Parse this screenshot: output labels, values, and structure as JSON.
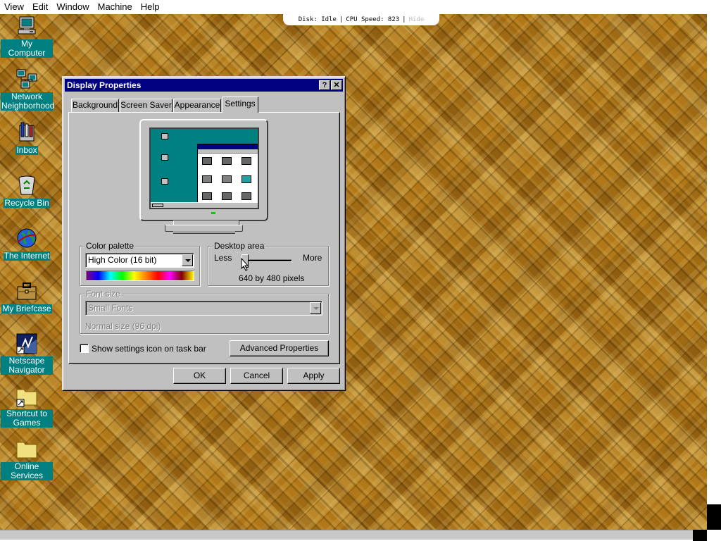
{
  "host_menu": {
    "items": [
      "View",
      "Edit",
      "Window",
      "Machine",
      "Help"
    ]
  },
  "host_status": {
    "disk": "Disk: Idle",
    "cpu": "CPU Speed: 823",
    "hide": "Hide"
  },
  "desktop_icons": [
    {
      "label": "My Computer",
      "icon": "computer-icon"
    },
    {
      "label": "Network Neighborhood",
      "icon": "network-icon"
    },
    {
      "label": "Inbox",
      "icon": "inbox-icon"
    },
    {
      "label": "Recycle Bin",
      "icon": "recycle-bin-icon"
    },
    {
      "label": "The Internet",
      "icon": "globe-icon"
    },
    {
      "label": "My Briefcase",
      "icon": "briefcase-icon"
    },
    {
      "label": "Netscape Navigator",
      "icon": "netscape-icon"
    },
    {
      "label": "Shortcut to Games",
      "icon": "folder-shortcut-icon"
    },
    {
      "label": "Online Services",
      "icon": "folder-icon"
    }
  ],
  "dialog": {
    "title": "Display Properties",
    "help_glyph": "?",
    "close_glyph": "✕",
    "tabs": [
      "Background",
      "Screen Saver",
      "Appearance",
      "Settings"
    ],
    "active_tab": "Settings",
    "color_palette": {
      "label": "Color palette",
      "value": "High Color (16 bit)"
    },
    "desktop_area": {
      "label": "Desktop area",
      "less": "Less",
      "more": "More",
      "resolution": "640 by 480 pixels",
      "slider_level": 0
    },
    "font_size": {
      "label": "Font size",
      "value": "Small Fonts",
      "detail": "Normal size (96 dpi)",
      "enabled": false
    },
    "show_settings_icon": {
      "label": "Show settings icon on task bar",
      "checked": false
    },
    "advanced_button": "Advanced Properties",
    "ok_button": "OK",
    "cancel_button": "Cancel",
    "apply_button": "Apply"
  },
  "colors": {
    "title_bar": "#000080",
    "desktop_teal": "#008080",
    "wallpaper": "#b07818",
    "face": "#c0c0c0"
  }
}
